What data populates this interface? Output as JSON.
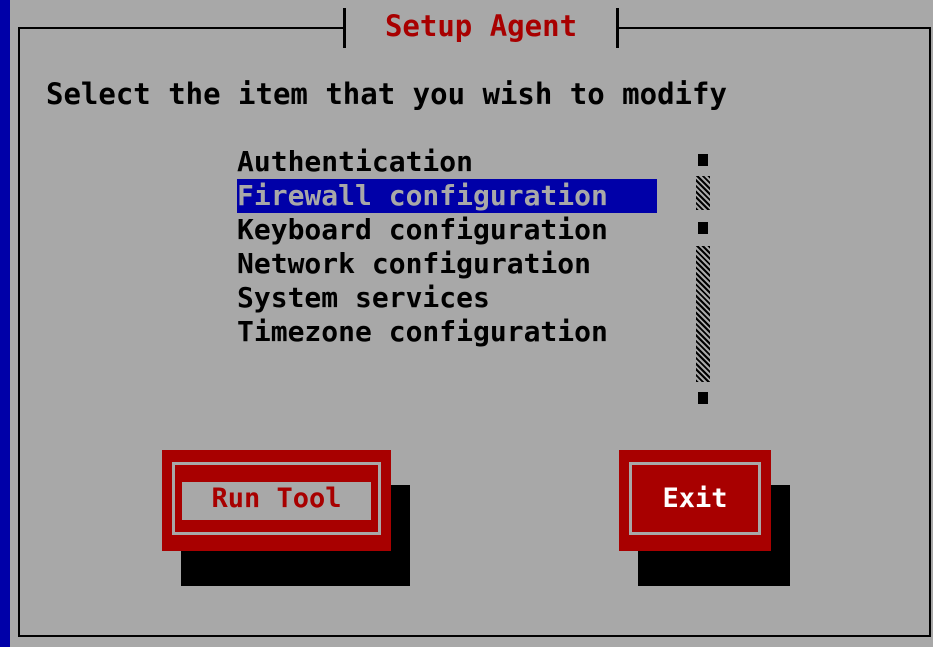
{
  "dialog": {
    "title": "Setup Agent",
    "prompt": "Select the item that you wish to modify"
  },
  "list": {
    "items": [
      {
        "label": "Authentication",
        "selected": false
      },
      {
        "label": "Firewall configuration",
        "selected": true
      },
      {
        "label": "Keyboard configuration",
        "selected": false
      },
      {
        "label": "Network configuration",
        "selected": false
      },
      {
        "label": "System services",
        "selected": false
      },
      {
        "label": "Timezone configuration",
        "selected": false
      }
    ]
  },
  "buttons": {
    "run_tool_label": "Run Tool",
    "exit_label": "Exit"
  },
  "colors": {
    "background": "#0000a8",
    "dialog": "#a8a8a8",
    "accent": "#a80000",
    "selection": "#0000a8"
  }
}
